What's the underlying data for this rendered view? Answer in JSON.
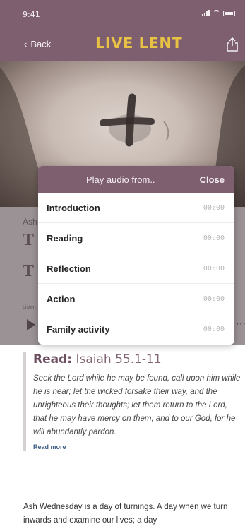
{
  "status_bar": {
    "time": "9:41"
  },
  "nav": {
    "back_label": "Back",
    "logo_text": "LIVE LENT"
  },
  "article_peek": {
    "label_fragment": "Ash",
    "title_line1_fragment": "T",
    "title_line2_fragment": "T",
    "listen_fragment": "Listen"
  },
  "modal": {
    "title": "Play audio from..",
    "close_label": "Close",
    "options": [
      {
        "label": "Introduction",
        "time": "00:00"
      },
      {
        "label": "Reading",
        "time": "00:00"
      },
      {
        "label": "Reflection",
        "time": "00:00"
      },
      {
        "label": "Action",
        "time": "00:00"
      },
      {
        "label": "Family activity",
        "time": "00:00"
      }
    ]
  },
  "reading": {
    "heading_bold": "Read:",
    "heading_ref": "Isaiah 55.1-11",
    "text": "Seek the Lord while he may be found, call upon him while he is near; let the wicked forsake their way, and the unrighteous their thoughts; let them return to the Lord, that he may have mercy on them, and to our God, for he will abundantly pardon.",
    "read_more": "Read more"
  },
  "body_text": "Ash Wednesday is a day of turnings. A day when we turn inwards and examine our lives; a day",
  "icons": [
    "back-chevron-icon",
    "share-icon",
    "play-icon",
    "more-icon"
  ],
  "colors": {
    "brand_purple": "#7e5f70",
    "logo_gold": "#e8c244",
    "link_blue": "#3f5f84"
  }
}
